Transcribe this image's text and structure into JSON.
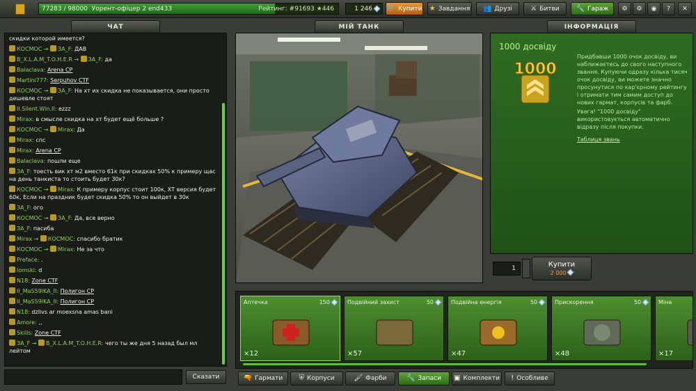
{
  "topbar": {
    "xp_current": "77283",
    "xp_total": "98000",
    "rank_name": "Уорент-офіцер 2",
    "username": "end433",
    "rating_label": "Рейтинг: #91693",
    "stars": "446",
    "xp_fraction": 0.788,
    "crystals": "1 246",
    "buy_label": "Купити",
    "missions_label": "Завдання",
    "friends_label": "Друзі",
    "battles_label": "Битви",
    "garage_label": "Гараж"
  },
  "chat": {
    "title": "ЧАТ",
    "say_label": "Сказати",
    "messages": [
      {
        "from": "",
        "to": "",
        "text": "скидки которой имеется?"
      },
      {
        "from": "КОСМОС",
        "to": "ЗА_F",
        "text": "ДАВ"
      },
      {
        "from": "B_X.L.A.M_T.O.H.E.R",
        "to": "ЗА_F",
        "text": "да"
      },
      {
        "from": "Balaclava",
        "to": "",
        "text": "Arena CP",
        "link": true
      },
      {
        "from": "Martini777",
        "to": "",
        "text": "Serpuhov CTF",
        "link": true
      },
      {
        "from": "КОСМОС",
        "to": "ЗА_F",
        "text": "На хт их скидка не показывается, они просто дешевле стоят"
      },
      {
        "from": "II.Silent.Win.II",
        "to": "",
        "text": "ezzz"
      },
      {
        "from": "Mirax",
        "to": "",
        "text": "в смысле скидка на хт будет ещё больше ?"
      },
      {
        "from": "КОСМОС",
        "to": "Mirax",
        "text": "Да"
      },
      {
        "from": "Mirax",
        "to": "",
        "text": "спс"
      },
      {
        "from": "Mirax",
        "to": "",
        "text": "Arena CP",
        "link": true
      },
      {
        "from": "Balaclava",
        "to": "",
        "text": "пошли еще"
      },
      {
        "from": "ЗА_F",
        "to": "",
        "text": "тоесть вик хт м2 вместо 61к при скидках 50% к примеру щас на день танкиста то стоить будет 30к?"
      },
      {
        "from": "КОСМОС",
        "to": "Mirax",
        "text": "К примеру корпус стоит 100к, ХТ версия будет 60к, Если на праздник будет скидка 50% то он выйдет в 30к"
      },
      {
        "from": "ЗА_F",
        "to": "",
        "text": "ого"
      },
      {
        "from": "КОСМОС",
        "to": "ЗА_F",
        "text": "Да, все верно"
      },
      {
        "from": "ЗА_F",
        "to": "",
        "text": "пасиба"
      },
      {
        "from": "Mirax",
        "to": "КОСМОС",
        "text": "спасибо братик"
      },
      {
        "from": "КОСМОС",
        "to": "Mirax",
        "text": "Не за что"
      },
      {
        "from": "Preface",
        "to": "",
        "text": "."
      },
      {
        "from": "lomski",
        "to": "",
        "text": "d"
      },
      {
        "from": "N18",
        "to": "",
        "text": "Zone CTF",
        "link": true
      },
      {
        "from": "II_MaS59lKA_II",
        "to": "",
        "text": "Полигон CP",
        "link": true
      },
      {
        "from": "II_MaS59lKA_II",
        "to": "",
        "text": "Полигон CP",
        "link": true
      },
      {
        "from": "N18",
        "to": "",
        "text": "dzlivs ar moexsna amas bani"
      },
      {
        "from": "Amore",
        "to": "",
        "text": ",,"
      },
      {
        "from": "Skills",
        "to": "",
        "text": "Zone CTF",
        "link": true
      },
      {
        "from": "ЗА_F",
        "to": "B_X.L.A.M_T.O.H.E.R",
        "text": "чего ты же дня 5 назад был мл лейтом"
      }
    ]
  },
  "garage": {
    "title": "МІЙ ТАНК"
  },
  "info": {
    "title": "ІНФОРМАЦІЯ",
    "heading": "1000 досвіду",
    "badge_number": "1000",
    "description": "Придбавши 1000 очок досвіду, ви наближаєтесь до свого наступного звання. Купуючи одразу кілька тисяч очок досвіду, ви можете значно просунутися по кар'єрному рейтингу і отримати тим самим доступ до нових гармат, корпусів та фарб.",
    "warning": "Увага! \"1000 досвіду\" використовується автоматично відразу після покупки.",
    "ranks_link": "Таблиця звань",
    "quantity": "1",
    "buy_label": "Купити",
    "price": "2 000"
  },
  "items": [
    {
      "name": "Аптечка",
      "price": "150",
      "count": "×12"
    },
    {
      "name": "Подвійний захист",
      "price": "50",
      "count": "×57"
    },
    {
      "name": "Подвійна енергія",
      "price": "50",
      "count": "×47"
    },
    {
      "name": "Прискорення",
      "price": "50",
      "count": "×48"
    },
    {
      "name": "Міна",
      "price": "",
      "count": "×17"
    }
  ],
  "tabs": [
    {
      "label": "Гармати",
      "icon": "turret-icon"
    },
    {
      "label": "Корпуси",
      "icon": "hull-icon"
    },
    {
      "label": "Фарби",
      "icon": "paint-icon"
    },
    {
      "label": "Запаси",
      "icon": "supplies-icon",
      "active": true
    },
    {
      "label": "Комплекти",
      "icon": "kits-icon"
    },
    {
      "label": "Особливе",
      "icon": "special-icon"
    }
  ]
}
